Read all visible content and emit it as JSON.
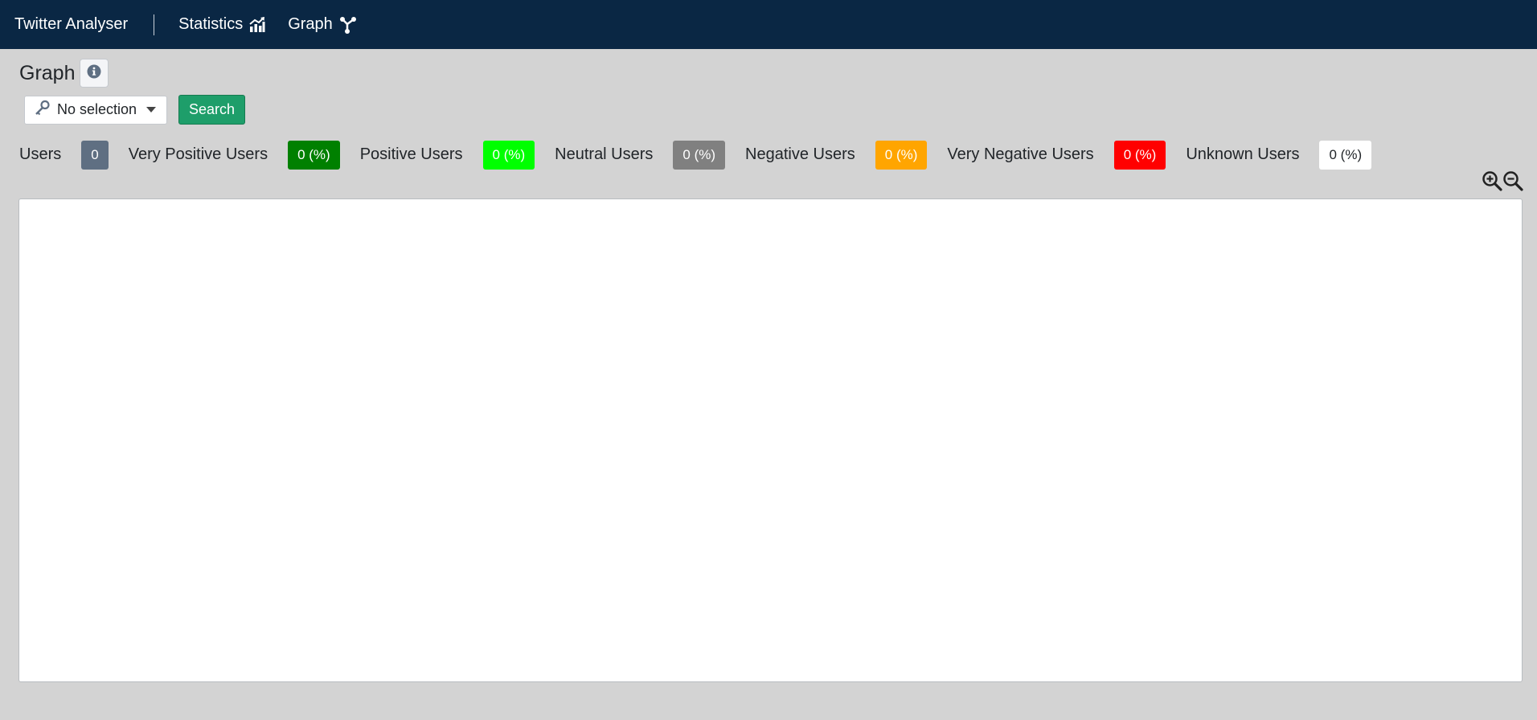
{
  "navbar": {
    "brand": "Twitter Analyser",
    "links": [
      {
        "label": "Statistics",
        "icon": "chart-line-icon"
      },
      {
        "label": "Graph",
        "icon": "graph-nodes-icon"
      }
    ],
    "background": "#0a2744"
  },
  "page": {
    "title": "Graph",
    "info_icon": "info-circle-icon"
  },
  "search": {
    "dropdown_icon": "key-icon",
    "dropdown_value": "No selection",
    "button_label": "Search",
    "button_color": "#1e9e6a"
  },
  "stats": [
    {
      "label": "Users",
      "value": "0",
      "color": "#5f6f82",
      "text_color": "#ffffff"
    },
    {
      "label": "Very Positive Users",
      "value": "0 (%)",
      "color": "#008000",
      "text_color": "#ffffff"
    },
    {
      "label": "Positive Users",
      "value": "0 (%)",
      "color": "#00ff00",
      "text_color": "#ffffff"
    },
    {
      "label": "Neutral Users",
      "value": "0 (%)",
      "color": "#808080",
      "text_color": "#ffffff"
    },
    {
      "label": "Negative Users",
      "value": "0 (%)",
      "color": "#ffa500",
      "text_color": "#ffffff"
    },
    {
      "label": "Very Negative Users",
      "value": "0 (%)",
      "color": "#ff0000",
      "text_color": "#ffffff"
    },
    {
      "label": "Unknown Users",
      "value": "0 (%)",
      "color": "#ffffff",
      "text_color": "#212529"
    }
  ],
  "zoom": {
    "zoom_in_icon": "zoom-in-icon",
    "zoom_out_icon": "zoom-out-icon"
  }
}
